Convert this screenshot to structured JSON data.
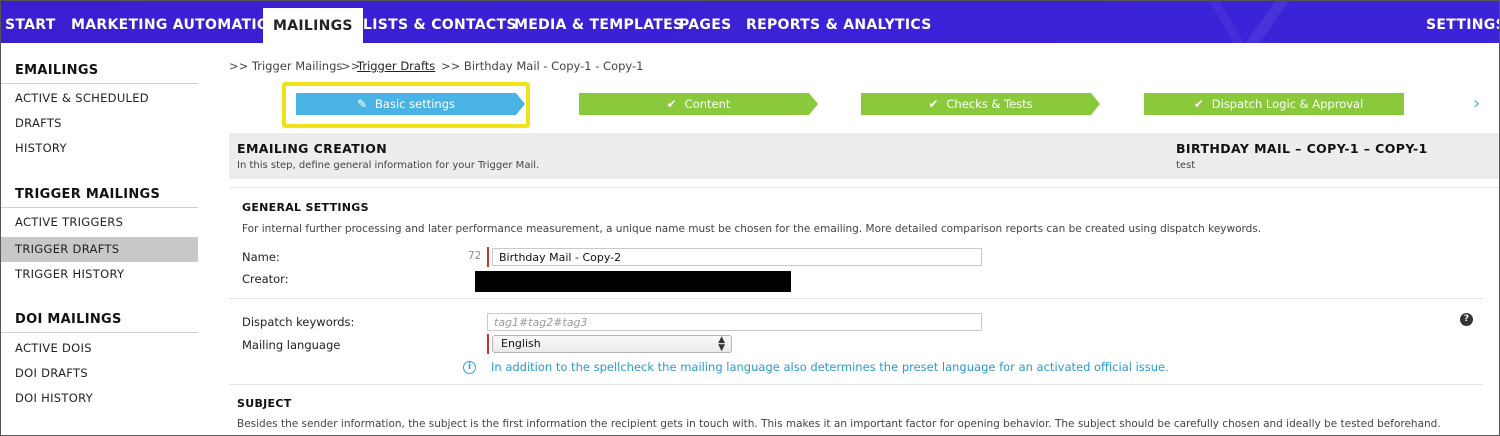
{
  "topnav": {
    "items": [
      {
        "label": "START"
      },
      {
        "label": "MARKETING AUTOMATION"
      },
      {
        "label": "MAILINGS"
      },
      {
        "label": "LISTS & CONTACTS"
      },
      {
        "label": "MEDIA & TEMPLATES"
      },
      {
        "label": "PAGES"
      },
      {
        "label": "REPORTS & ANALYTICS"
      }
    ],
    "settings_label": "SETTINGS",
    "active": "MAILINGS",
    "color": "#3a1fd1"
  },
  "sidebar": {
    "groups": [
      {
        "heading": "EMAILINGS",
        "items": [
          "ACTIVE & SCHEDULED",
          "DRAFTS",
          "HISTORY"
        ]
      },
      {
        "heading": "TRIGGER MAILINGS",
        "items": [
          "ACTIVE TRIGGERS",
          "TRIGGER DRAFTS",
          "TRIGGER HISTORY"
        ]
      },
      {
        "heading": "DOI MAILINGS",
        "items": [
          "ACTIVE DOIS",
          "DOI DRAFTS",
          "DOI HISTORY"
        ]
      }
    ],
    "active_item": "TRIGGER DRAFTS"
  },
  "breadcrumb": {
    "items": [
      ">> Trigger Mailings",
      ">> ",
      "Trigger Drafts",
      ">> Birthday Mail - Copy-1 - Copy-1"
    ]
  },
  "steps": {
    "items": [
      {
        "label": "Basic settings",
        "icon": "pencil-icon",
        "state": "current",
        "color": "#4ab3e6"
      },
      {
        "label": "Content",
        "icon": "check-icon",
        "state": "done",
        "color": "#8bc93c"
      },
      {
        "label": "Checks & Tests",
        "icon": "check-icon",
        "state": "done",
        "color": "#8bc93c"
      },
      {
        "label": "Dispatch Logic & Approval",
        "icon": "check-icon",
        "state": "done",
        "color": "#8bc93c"
      }
    ],
    "highlight_color": "#f3e21a"
  },
  "header": {
    "title": "EMAILING CREATION",
    "subtitle": "In this step, define general information for your Trigger Mail.",
    "mailing_name": "BIRTHDAY MAIL – COPY-1 – COPY-1",
    "mailing_desc": "test"
  },
  "general": {
    "title": "GENERAL SETTINGS",
    "description": "For internal further processing and later performance measurement, a unique name must be chosen for the emailing. More detailed comparison reports can be created using dispatch keywords.",
    "name_label": "Name:",
    "name_counter": "72",
    "name_value": "Birthday Mail - Copy-2",
    "creator_label": "Creator:",
    "keywords_label": "Dispatch keywords:",
    "keywords_placeholder": "tag1#tag2#tag3",
    "language_label": "Mailing language",
    "language_value": "English",
    "language_hint": "In addition to the spellcheck the mailing language also determines the preset language for an activated official issue."
  },
  "subject": {
    "title": "SUBJECT",
    "description": "Besides the sender information, the subject is the first information the recipient gets in touch with. This makes it an important factor for opening behavior. The subject should be carefully chosen and ideally be tested beforehand."
  }
}
